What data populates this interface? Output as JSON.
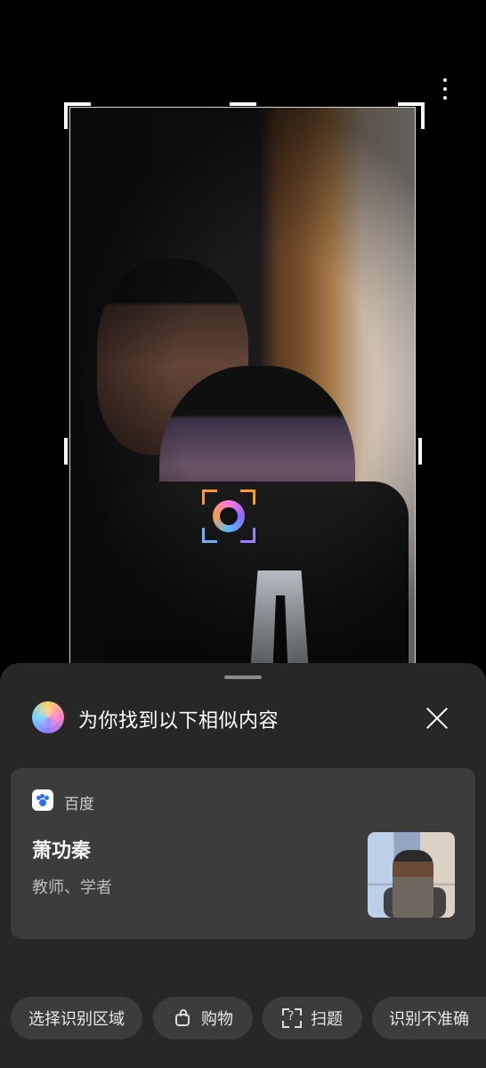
{
  "sheet": {
    "title": "为你找到以下相似内容"
  },
  "result": {
    "source": "百度",
    "name": "萧功秦",
    "description": "教师、学者"
  },
  "actions": [
    {
      "label": "选择识别区域"
    },
    {
      "label": "购物"
    },
    {
      "label": "扫题"
    },
    {
      "label": "识别不准确"
    }
  ],
  "icons": {
    "menu": "more-vertical-icon",
    "close": "close-icon",
    "brand": "visual-search-icon",
    "source": "baidu-icon",
    "shopping": "bag-icon",
    "scan": "scan-question-icon",
    "focus": "focus-icon"
  }
}
